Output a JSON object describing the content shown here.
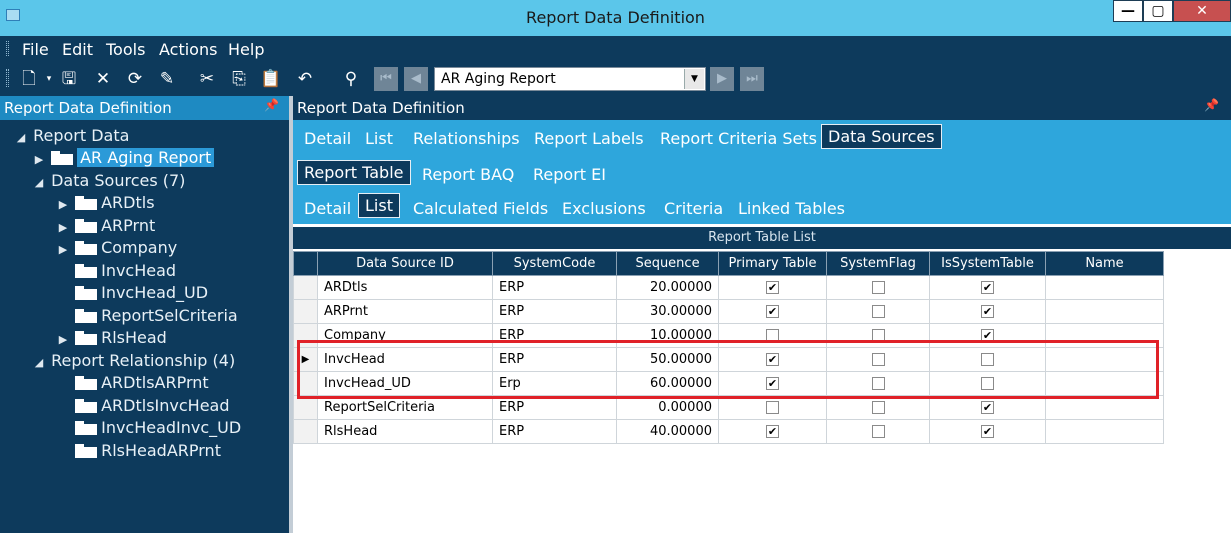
{
  "window": {
    "title": "Report Data Definition",
    "buttons": {
      "minimize": "—",
      "maximize": "▢",
      "close": "✕"
    }
  },
  "menu": {
    "items": [
      "File",
      "Edit",
      "Tools",
      "Actions",
      "Help"
    ]
  },
  "toolbar": {
    "icons": [
      "new-icon",
      "save-icon",
      "delete-icon",
      "refresh-icon",
      "clear-icon",
      "cut-icon",
      "copy-icon",
      "paste-icon",
      "undo-icon",
      "search-icon"
    ],
    "selected_report": "AR Aging Report"
  },
  "left_panel": {
    "title": "Report Data Definition",
    "tree": {
      "root": "Report Data",
      "report": "AR Aging Report",
      "data_sources_label": "Data Sources (7)",
      "data_sources": [
        "ARDtls",
        "ARPrnt",
        "Company",
        "InvcHead",
        "InvcHead_UD",
        "ReportSelCriteria",
        "RlsHead"
      ],
      "relationships_label": "Report Relationship (4)",
      "relationships": [
        "ARDtlsARPrnt",
        "ARDtlsInvcHead",
        "InvcHeadInvc_UD",
        "RlsHeadARPrnt"
      ]
    }
  },
  "right_panel": {
    "title": "Report Data Definition",
    "tabs_level1": [
      "Detail",
      "List",
      "Relationships",
      "Report Labels",
      "Report Criteria Sets",
      "Data Sources"
    ],
    "tabs_level2": [
      "Report Table",
      "Report BAQ",
      "Report EI"
    ],
    "tabs_level3": [
      "Detail",
      "List",
      "Calculated Fields",
      "Exclusions",
      "Criteria",
      "Linked Tables"
    ],
    "grid": {
      "caption": "Report Table List",
      "columns": [
        "Data Source ID",
        "SystemCode",
        "Sequence",
        "Primary Table",
        "SystemFlag",
        "IsSystemTable",
        "Name"
      ],
      "rows": [
        {
          "id": "ARDtls",
          "code": "ERP",
          "seq": "20.00000",
          "primary": true,
          "sysflag": false,
          "issys": true,
          "name": ""
        },
        {
          "id": "ARPrnt",
          "code": "ERP",
          "seq": "30.00000",
          "primary": true,
          "sysflag": false,
          "issys": true,
          "name": ""
        },
        {
          "id": "Company",
          "code": "ERP",
          "seq": "10.00000",
          "primary": false,
          "sysflag": false,
          "issys": true,
          "name": ""
        },
        {
          "id": "InvcHead",
          "code": "ERP",
          "seq": "50.00000",
          "primary": true,
          "sysflag": false,
          "issys": false,
          "name": ""
        },
        {
          "id": "InvcHead_UD",
          "code": "Erp",
          "seq": "60.00000",
          "primary": true,
          "sysflag": false,
          "issys": false,
          "name": ""
        },
        {
          "id": "ReportSelCriteria",
          "code": "ERP",
          "seq": "0.00000",
          "primary": false,
          "sysflag": false,
          "issys": true,
          "name": ""
        },
        {
          "id": "RlsHead",
          "code": "ERP",
          "seq": "40.00000",
          "primary": true,
          "sysflag": false,
          "issys": true,
          "name": ""
        }
      ]
    }
  },
  "colors": {
    "title_bar": "#5bc6ea",
    "dark_navy": "#0d3a5c",
    "tab_blue": "#2ea6dc",
    "highlight_red": "#e02128"
  }
}
